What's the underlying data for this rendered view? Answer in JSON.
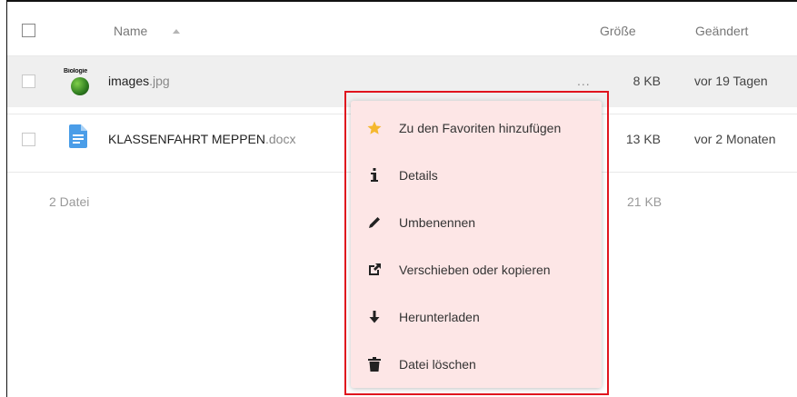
{
  "header": {
    "name_label": "Name",
    "size_label": "Größe",
    "changed_label": "Geändert"
  },
  "files": [
    {
      "thumbnail_text": "Biologie",
      "name": "images",
      "ext": ".jpg",
      "size": "8 KB",
      "changed": "vor 19 Tagen",
      "actions_label": "..."
    },
    {
      "name": "KLASSENFAHRT MEPPEN",
      "ext": ".docx",
      "size": "13 KB",
      "changed": "vor 2 Monaten"
    }
  ],
  "summary": {
    "files": "2 Datei",
    "total_size": "21 KB"
  },
  "context_menu": {
    "items": [
      {
        "label": "Zu den Favoriten hinzufügen",
        "icon": "star-icon"
      },
      {
        "label": "Details",
        "icon": "info-icon"
      },
      {
        "label": "Umbenennen",
        "icon": "pencil-icon"
      },
      {
        "label": "Verschieben oder kopieren",
        "icon": "external-link-icon"
      },
      {
        "label": "Herunterladen",
        "icon": "download-icon"
      },
      {
        "label": "Datei löschen",
        "icon": "trash-icon"
      }
    ]
  },
  "colors": {
    "highlight_border": "#e0141e",
    "menu_background": "#fde6e6",
    "star": "#f5b82e",
    "doc_icon": "#4a9de8"
  }
}
